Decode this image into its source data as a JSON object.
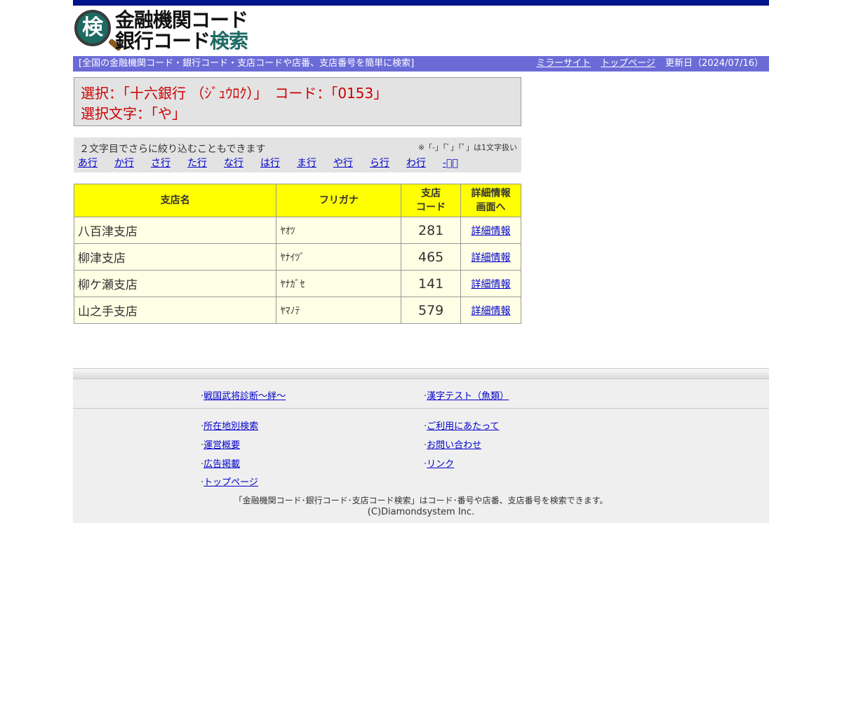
{
  "header": {
    "logo_badge": "検",
    "logo_line1": "金融機関コード",
    "logo_line2_a": "銀行コード",
    "logo_line2_b": "検索",
    "tagline": "[全国の金融機関コード・銀行コード・支店コードや店番、支店番号を簡単に検索]",
    "nav_mirror": "ミラーサイト",
    "nav_top": "トップページ",
    "updated": "更新日（2024/07/16）"
  },
  "selection": {
    "line1": "選択：「十六銀行 （ｼﾞｭｳﾛｸ）」　コード：「0153」",
    "line2": "選択文字：「や」"
  },
  "kana_filter": {
    "hint": "２文字目でさらに絞り込むこともできます",
    "note": "※「-」「ﾞ」「ﾟ」は1文字扱い",
    "items": [
      "あ行",
      "か行",
      "さ行",
      "た行",
      "な行",
      "は行",
      "ま行",
      "や行",
      "ら行",
      "わ行",
      "-ﾞﾟ"
    ]
  },
  "table": {
    "headers": {
      "name": "支店名",
      "kana": "フリガナ",
      "code_1": "支店",
      "code_2": "コード",
      "detail_1": "詳細情報",
      "detail_2": "画面へ"
    },
    "rows": [
      {
        "name": "八百津支店",
        "kana": "ﾔｵﾂ",
        "code": "281",
        "link": "詳細情報"
      },
      {
        "name": "柳津支店",
        "kana": "ﾔﾅｲﾂﾞ",
        "code": "465",
        "link": "詳細情報"
      },
      {
        "name": "柳ケ瀬支店",
        "kana": "ﾔﾅｶﾞｾ",
        "code": "141",
        "link": "詳細情報"
      },
      {
        "name": "山之手支店",
        "kana": "ﾔﾏﾉﾃ",
        "code": "579",
        "link": "詳細情報"
      }
    ]
  },
  "footer": {
    "promo_left": "戦国武将診断～絆～",
    "promo_right": "漢字テスト（魚類）",
    "links_left": [
      "所在地別検索",
      "運営概要",
      "広告掲載",
      "トップページ"
    ],
    "links_right": [
      "ご利用にあたって",
      "お問い合わせ",
      "リンク"
    ],
    "description": "「金融機関コード･銀行コード･支店コード検索」はコード･番号や店番、支店番号を検索できます。",
    "copyright": "(C)Diamondsystem Inc."
  },
  "colors": {
    "topbar": "#00148a",
    "navbar": "#6b6bd8",
    "selection_text": "#cc0000",
    "table_header": "#ffff00",
    "table_cell": "#ffffe5",
    "logo_green": "#1d6a63"
  }
}
